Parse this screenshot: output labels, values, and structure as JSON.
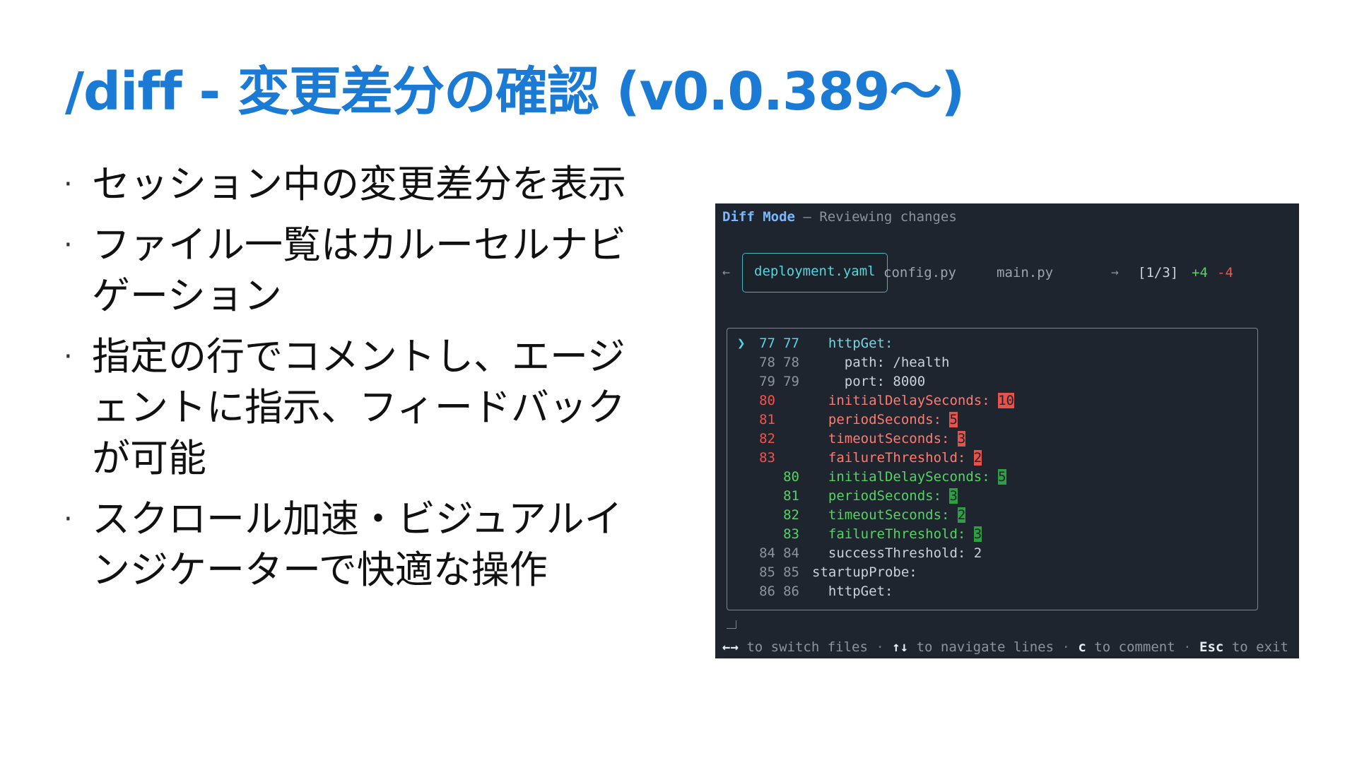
{
  "slide": {
    "title": "/diff - 変更差分の確認 (v0.0.389～)",
    "bullets": [
      "セッション中の変更差分を表示",
      "ファイル一覧はカルーセルナビゲーション",
      "指定の行でコメントし、エージェントに指示、フィードバックが可能",
      "スクロール加速・ビジュアルインジケーターで快適な操作"
    ],
    "bullet_glyph": "·"
  },
  "terminal": {
    "mode_label": "Diff Mode",
    "mode_separator": "–",
    "mode_description": "Reviewing changes",
    "prev_arrow": "←",
    "next_arrow": "→",
    "tabs": [
      "deployment.yaml",
      "config.py",
      "main.py"
    ],
    "active_tab": 0,
    "counter": "[1/3]",
    "added": "+4",
    "removed": "-4",
    "cursor_glyph": "❯",
    "lines": [
      {
        "old": "77",
        "new": "77",
        "code": "  httpGet:",
        "kind": "ctx",
        "selected": true
      },
      {
        "old": "78",
        "new": "78",
        "code": "    path: /health",
        "kind": "ctx"
      },
      {
        "old": "79",
        "new": "79",
        "code": "    port: 8000",
        "kind": "ctx"
      },
      {
        "old": "80",
        "new": "",
        "code": "  initialDelaySeconds: ",
        "value": "10",
        "kind": "del"
      },
      {
        "old": "81",
        "new": "",
        "code": "  periodSeconds: ",
        "value": "5",
        "kind": "del"
      },
      {
        "old": "82",
        "new": "",
        "code": "  timeoutSeconds: ",
        "value": "3",
        "kind": "del"
      },
      {
        "old": "83",
        "new": "",
        "code": "  failureThreshold: ",
        "value": "2",
        "kind": "del"
      },
      {
        "old": "",
        "new": "80",
        "code": "  initialDelaySeconds: ",
        "value": "5",
        "kind": "add"
      },
      {
        "old": "",
        "new": "81",
        "code": "  periodSeconds: ",
        "value": "3",
        "kind": "add"
      },
      {
        "old": "",
        "new": "82",
        "code": "  timeoutSeconds: ",
        "value": "2",
        "kind": "add"
      },
      {
        "old": "",
        "new": "83",
        "code": "  failureThreshold: ",
        "value": "3",
        "kind": "add"
      },
      {
        "old": "84",
        "new": "84",
        "code": "  successThreshold: 2",
        "kind": "ctx"
      },
      {
        "old": "85",
        "new": "85",
        "code": "startupProbe:",
        "kind": "ctx"
      },
      {
        "old": "86",
        "new": "86",
        "code": "  httpGet:",
        "kind": "ctx"
      }
    ],
    "footer": {
      "switch_key": "←→",
      "switch_text": " to switch files ",
      "nav_key": "↑↓",
      "nav_text": " to navigate lines ",
      "comment_key": "c",
      "comment_text": " to comment ",
      "exit_key": "Esc",
      "exit_text": " to exit",
      "separator": "·"
    },
    "colors": {
      "background": "#1e252e",
      "accent": "#56d4e0",
      "added": "#56d364",
      "removed": "#f85149"
    }
  }
}
